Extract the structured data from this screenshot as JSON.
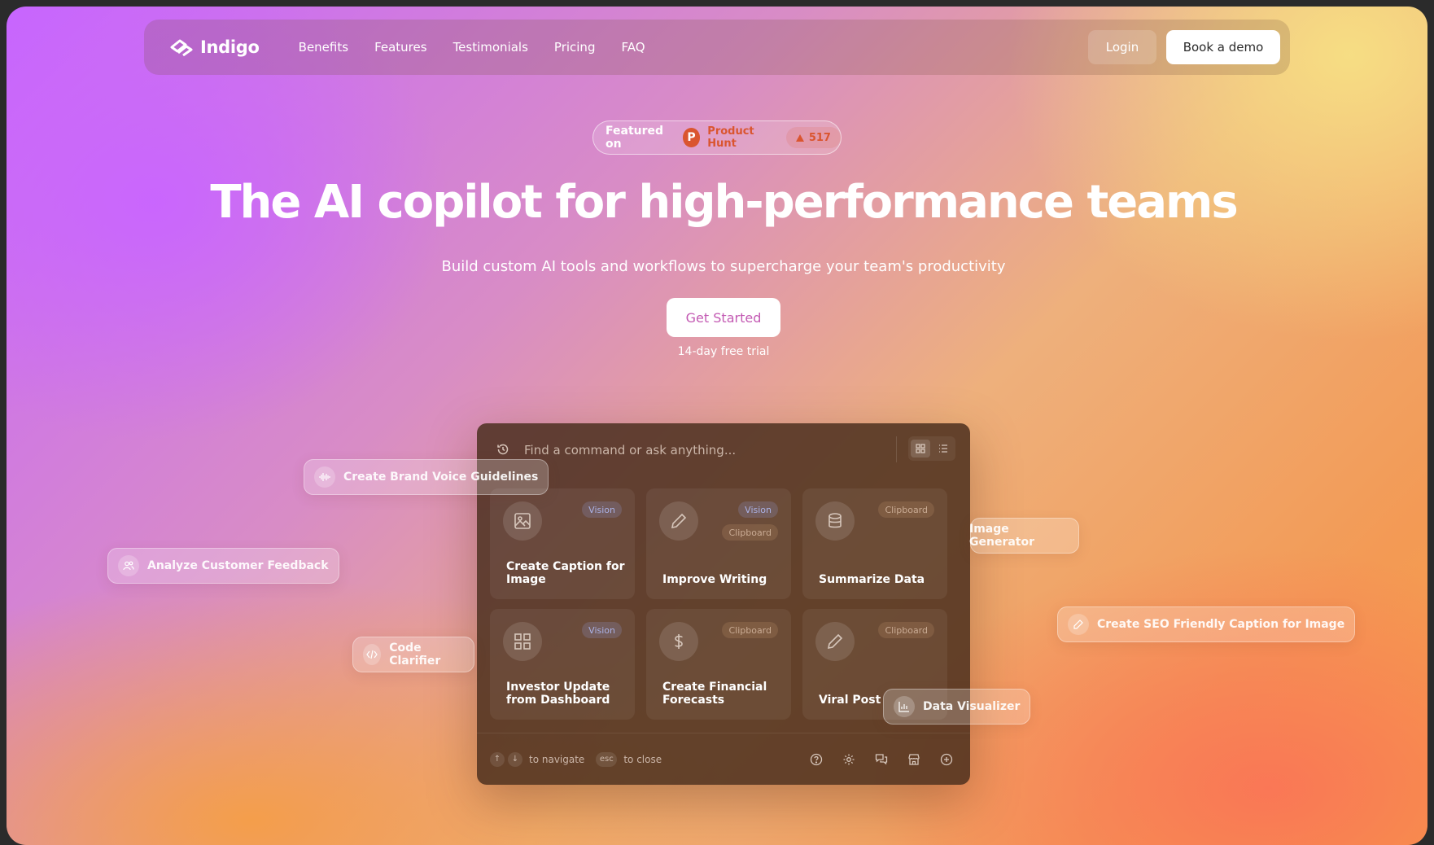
{
  "brand": {
    "name": "Indigo"
  },
  "nav": {
    "links": [
      "Benefits",
      "Features",
      "Testimonials",
      "Pricing",
      "FAQ"
    ],
    "login": "Login",
    "demo": "Book a demo"
  },
  "badge": {
    "lead": "Featured on",
    "product_logo": "P",
    "product": "Product Hunt",
    "upvotes": "517"
  },
  "hero": {
    "title": "The AI copilot for high-performance teams",
    "subtitle": "Build custom AI tools and workflows to supercharge your team's productivity",
    "cta": "Get Started",
    "trial": "14-day free trial"
  },
  "palette": {
    "placeholder": "Find a command or ask anything...",
    "cards": [
      {
        "title": "Create Caption for Image",
        "tags": [
          "Vision"
        ],
        "icon": "image-icon"
      },
      {
        "title": "Improve Writing",
        "tags": [
          "Vision",
          "Clipboard"
        ],
        "icon": "pencil-icon"
      },
      {
        "title": "Summarize Data",
        "tags": [
          "Clipboard"
        ],
        "icon": "database-icon"
      },
      {
        "title": "Investor Update from Dashboard",
        "tags": [
          "Vision"
        ],
        "icon": "dashboard-icon"
      },
      {
        "title": "Create Financial Forecasts",
        "tags": [
          "Clipboard"
        ],
        "icon": "dollar-icon"
      },
      {
        "title": "Viral Post",
        "tags": [
          "Clipboard"
        ],
        "icon": "pencil-icon"
      }
    ],
    "footer": {
      "navigate": "to navigate",
      "esc": "esc",
      "close": "to close"
    }
  },
  "floating": {
    "brand_voice": "Create Brand Voice Guidelines",
    "customer_feedback": "Analyze Customer Feedback",
    "code_clarifier": "Code Clarifier",
    "image_generator": "Image Generator",
    "seo_caption": "Create SEO Friendly Caption for Image",
    "data_visualizer": "Data Visualizer"
  }
}
